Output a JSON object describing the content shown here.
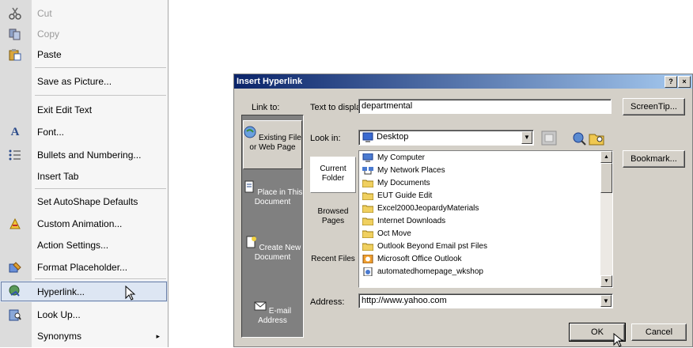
{
  "context_menu": {
    "items": [
      {
        "label": "Cut",
        "icon": "scissors-icon",
        "disabled": true
      },
      {
        "label": "Copy",
        "icon": "copy-icon",
        "disabled": true
      },
      {
        "label": "Paste",
        "icon": "paste-icon",
        "disabled": false
      },
      {
        "label": "Save as Picture...",
        "icon": "",
        "disabled": false
      },
      {
        "label": "Exit Edit Text",
        "icon": "",
        "disabled": false
      },
      {
        "label": "Font...",
        "icon": "font-icon",
        "disabled": false
      },
      {
        "label": "Bullets and Numbering...",
        "icon": "bullets-icon",
        "disabled": false
      },
      {
        "label": "Insert Tab",
        "icon": "",
        "disabled": false
      },
      {
        "label": "Set AutoShape Defaults",
        "icon": "",
        "disabled": false
      },
      {
        "label": "Custom Animation...",
        "icon": "animation-icon",
        "disabled": false
      },
      {
        "label": "Action Settings...",
        "icon": "",
        "disabled": false
      },
      {
        "label": "Format Placeholder...",
        "icon": "format-icon",
        "disabled": false
      },
      {
        "label": "Hyperlink...",
        "icon": "hyperlink-icon",
        "disabled": false,
        "highlighted": true
      },
      {
        "label": "Look Up...",
        "icon": "lookup-icon",
        "disabled": false
      },
      {
        "label": "Synonyms",
        "icon": "",
        "disabled": false,
        "submenu": true
      }
    ],
    "submenu_arrow": "▸"
  },
  "dialog": {
    "title": "Insert Hyperlink",
    "help_btn": "?",
    "close_btn": "×",
    "link_to_label": "Link to:",
    "text_to_display_label": "Text to display:",
    "text_to_display_value": "departmental",
    "screentip_button": "ScreenTip...",
    "look_in_label": "Look in:",
    "look_in_value": "Desktop",
    "bookmark_button": "Bookmark...",
    "address_label": "Address:",
    "address_value": "http://www.yahoo.com",
    "ok_button": "OK",
    "cancel_button": "Cancel",
    "link_targets": [
      {
        "label": "Existing File or Web Page",
        "selected": true
      },
      {
        "label": "Place in This Document",
        "selected": false
      },
      {
        "label": "Create New Document",
        "selected": false
      },
      {
        "label": "E-mail Address",
        "selected": false
      }
    ],
    "browse_tabs": [
      {
        "label": "Current Folder",
        "selected": true
      },
      {
        "label": "Browsed Pages",
        "selected": false
      },
      {
        "label": "Recent Files",
        "selected": false
      }
    ],
    "file_list": [
      {
        "label": "My Computer",
        "icon": "computer-icon"
      },
      {
        "label": "My Network Places",
        "icon": "network-icon"
      },
      {
        "label": "My Documents",
        "icon": "folder-icon"
      },
      {
        "label": "EUT Guide Edit",
        "icon": "folder-icon"
      },
      {
        "label": "Excel2000JeopardyMaterials",
        "icon": "folder-icon"
      },
      {
        "label": "Internet Downloads",
        "icon": "folder-icon"
      },
      {
        "label": "Oct Move",
        "icon": "folder-icon"
      },
      {
        "label": "Outlook Beyond Email pst Files",
        "icon": "folder-icon"
      },
      {
        "label": "Microsoft Office Outlook",
        "icon": "outlook-icon"
      },
      {
        "label": "automatedhomepage_wkshop",
        "icon": "html-file-icon"
      }
    ]
  },
  "colors": {
    "titlebar_start": "#0a246a",
    "titlebar_end": "#a6caf0",
    "dialog_face": "#d4d0c8"
  }
}
